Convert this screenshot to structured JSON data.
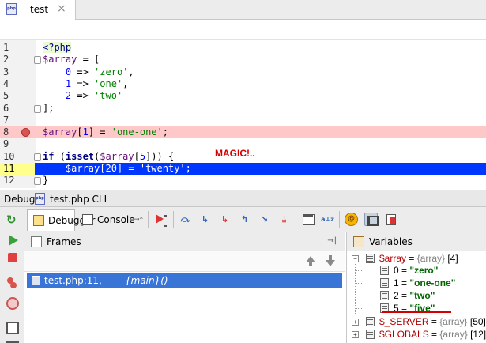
{
  "tab": {
    "label": "test",
    "file_icon": "php-file-icon",
    "close": "×"
  },
  "editor": {
    "magic_label": "MAGIC!..",
    "lines": [
      {
        "n": "1",
        "segments": [
          [
            "<?php",
            "php-tag"
          ]
        ]
      },
      {
        "n": "2",
        "segments": [
          [
            "$array",
            "var"
          ],
          [
            " = [",
            ""
          ]
        ]
      },
      {
        "n": "3",
        "segments": [
          [
            "    ",
            ""
          ],
          [
            "0",
            "num"
          ],
          [
            " => ",
            ""
          ],
          [
            "'zero'",
            "str"
          ],
          [
            ",",
            ""
          ]
        ]
      },
      {
        "n": "4",
        "segments": [
          [
            "    ",
            ""
          ],
          [
            "1",
            "num"
          ],
          [
            " => ",
            ""
          ],
          [
            "'one'",
            "str"
          ],
          [
            ",",
            ""
          ]
        ]
      },
      {
        "n": "5",
        "segments": [
          [
            "    ",
            ""
          ],
          [
            "2",
            "num"
          ],
          [
            " => ",
            ""
          ],
          [
            "'two'",
            "str"
          ]
        ]
      },
      {
        "n": "6",
        "segments": [
          [
            "];",
            ""
          ]
        ]
      },
      {
        "n": "7",
        "segments": []
      },
      {
        "n": "8",
        "segments": [
          [
            "$array",
            "var"
          ],
          [
            "[",
            ""
          ],
          [
            "1",
            "num"
          ],
          [
            "] = ",
            ""
          ],
          [
            "'one-one'",
            "str"
          ],
          [
            ";",
            ""
          ]
        ]
      },
      {
        "n": "9",
        "segments": []
      },
      {
        "n": "10",
        "segments": [
          [
            "if",
            "kw"
          ],
          [
            " (",
            ""
          ],
          [
            "isset",
            "kw"
          ],
          [
            "(",
            ""
          ],
          [
            "$array",
            "var"
          ],
          [
            "[",
            ""
          ],
          [
            "5",
            "num"
          ],
          [
            "])) {",
            ""
          ]
        ]
      },
      {
        "n": "11",
        "segments": [
          [
            "    ",
            ""
          ],
          [
            "$array",
            "var"
          ],
          [
            "[",
            ""
          ],
          [
            "20",
            "num"
          ],
          [
            "] = ",
            ""
          ],
          [
            "'twenty'",
            "str"
          ],
          [
            ";",
            ""
          ]
        ]
      },
      {
        "n": "12",
        "segments": [
          [
            "}",
            ""
          ]
        ]
      }
    ]
  },
  "debug_title": {
    "label": "Debug",
    "config": "test.php CLI"
  },
  "debug_tabs": {
    "debugger": "Debugger",
    "console": "Console",
    "console_pin": "→*"
  },
  "frames": {
    "title": "Frames",
    "pin": "→|",
    "rows": [
      {
        "location": "test.php:11,",
        "function": "{main}()"
      }
    ]
  },
  "variables": {
    "title": "Variables",
    "root": {
      "name": "$array",
      "type": "{array}",
      "count": "[4]"
    },
    "items": [
      {
        "key": "0",
        "value": "\"zero\""
      },
      {
        "key": "1",
        "value": "\"one-one\""
      },
      {
        "key": "2",
        "value": "\"two\""
      },
      {
        "key": "5",
        "value": "\"five\""
      }
    ],
    "globals": [
      {
        "name": "$_SERVER",
        "type": "{array}",
        "count": "[50]"
      },
      {
        "name": "$GLOBALS",
        "type": "{array}",
        "count": "[12]"
      }
    ]
  },
  "toolbar_glyphs": {
    "step_over": "⤼",
    "step_into": "↳",
    "force_step_into": "↳",
    "step_out": "↰",
    "run_to_cursor": "↘",
    "eval_sort": "a↓z",
    "php_badge": "@"
  },
  "left_toolbar": {
    "rerun": "↻"
  },
  "colors": {
    "breakpoint_line": "#ffc8c8",
    "execution_line": "#0037ff",
    "selection": "#3875d7",
    "string": "#008000",
    "variable": "#660e7a"
  }
}
